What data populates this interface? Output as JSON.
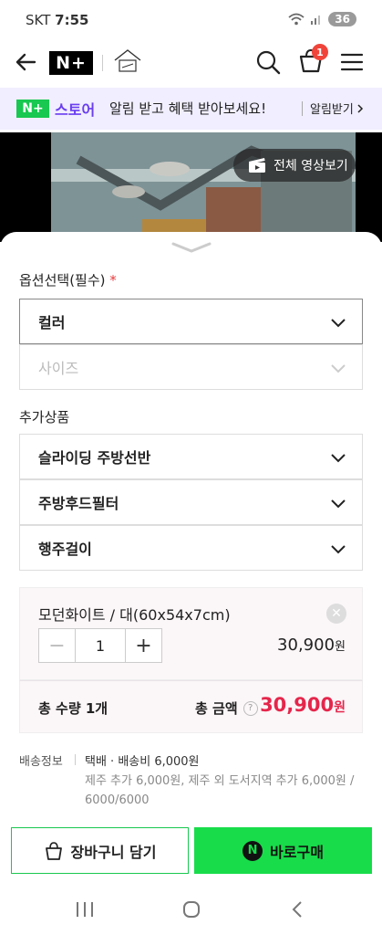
{
  "status_bar": {
    "carrier": "SKT",
    "time": "7:55",
    "battery": "36"
  },
  "header": {
    "brand": "N+",
    "logo_icon": "house-logo",
    "cart_count": "1"
  },
  "promo": {
    "badge": "N+",
    "store": "스토어",
    "message": "알림 받고 혜택 받아보세요!",
    "action": "알림받기"
  },
  "media": {
    "video_button": "전체 영상보기"
  },
  "options": {
    "title": "옵션선택(필수)",
    "required_mark": "*",
    "selects": [
      {
        "label": "컬러",
        "state": "active"
      },
      {
        "label": "사이즈",
        "state": "disabled"
      }
    ]
  },
  "addons": {
    "title": "추가상품",
    "items": [
      "슬라이딩 주방선반",
      "주방후드필터",
      "행주걸이"
    ]
  },
  "selected_item": {
    "name": "모던화이트 / 대(60x54x7cm)",
    "quantity": "1",
    "price": "30,900",
    "currency": "원"
  },
  "total": {
    "quantity_label": "총 수량 1개",
    "amount_label": "총 금액",
    "help": "?",
    "amount": "30,900",
    "currency": "원"
  },
  "shipping": {
    "label": "배송정보",
    "main": "택배 · 배송비 6,000원",
    "extra": "제주 추가 6,000원, 제주 외 도서지역 추가 6,000원 / 6000/6000"
  },
  "actions": {
    "cart": "장바구니 담기",
    "buy": "바로구매",
    "buy_badge": "N"
  },
  "colors": {
    "accent_green": "#18dc4a",
    "price_red": "#e5264b",
    "store_purple": "#6a3ef0"
  }
}
